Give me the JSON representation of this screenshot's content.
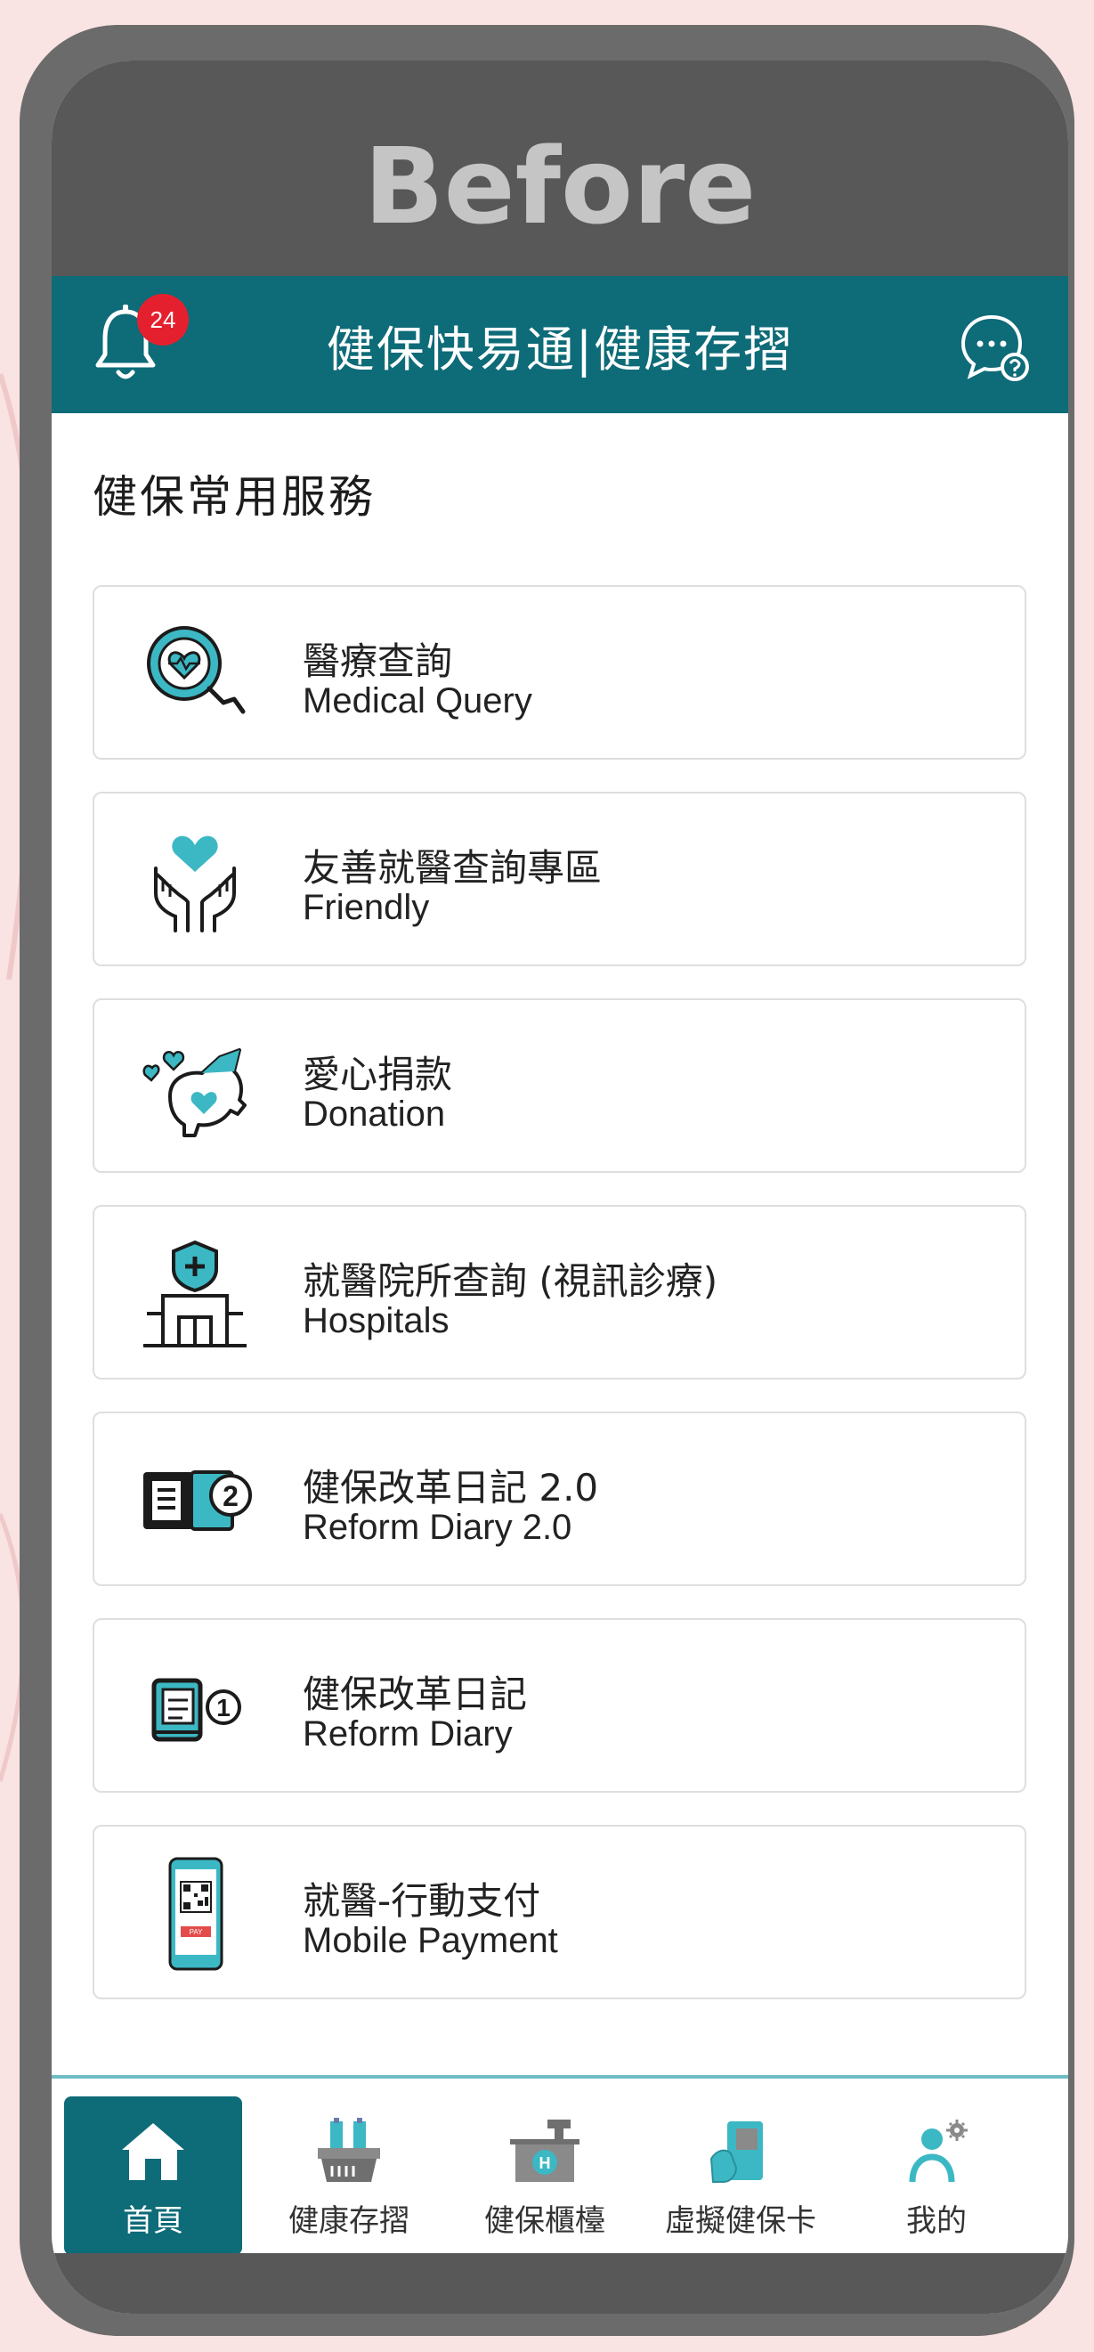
{
  "caption": "Before",
  "header": {
    "title": "健保快易通|健康存摺",
    "notification_count": "24",
    "bell_icon": "bell-icon",
    "chat_icon": "chat-help-icon"
  },
  "section_title": "健保常用服務",
  "services": [
    {
      "zh": "醫療查詢",
      "en": "Medical Query",
      "icon": "medical-query-icon"
    },
    {
      "zh": "友善就醫查詢專區",
      "en": "Friendly",
      "icon": "friendly-hands-heart-icon"
    },
    {
      "zh": "愛心捐款",
      "en": "Donation",
      "icon": "donation-piggy-icon"
    },
    {
      "zh": "就醫院所查詢 (視訊診療)",
      "en": "Hospitals",
      "icon": "hospital-icon"
    },
    {
      "zh": "健保改革日記 2.0",
      "en": "Reform Diary 2.0",
      "icon": "diary-2-icon"
    },
    {
      "zh": "健保改革日記",
      "en": "Reform Diary",
      "icon": "diary-1-icon"
    },
    {
      "zh": "就醫-行動支付",
      "en": "Mobile Payment",
      "icon": "mobile-payment-icon"
    }
  ],
  "tabs": [
    {
      "label": "首頁",
      "icon": "home-icon",
      "active": true
    },
    {
      "label": "健康存摺",
      "icon": "health-passbook-icon",
      "active": false
    },
    {
      "label": "健保櫃檯",
      "icon": "counter-icon",
      "active": false
    },
    {
      "label": "虛擬健保卡",
      "icon": "virtual-card-icon",
      "active": false
    },
    {
      "label": "我的",
      "icon": "profile-settings-icon",
      "active": false
    }
  ],
  "colors": {
    "header": "#0e6b78",
    "accent": "#3cb8c4",
    "badge": "#e5202e",
    "frame": "#6b6b6b",
    "background": "#f9e3e3"
  }
}
